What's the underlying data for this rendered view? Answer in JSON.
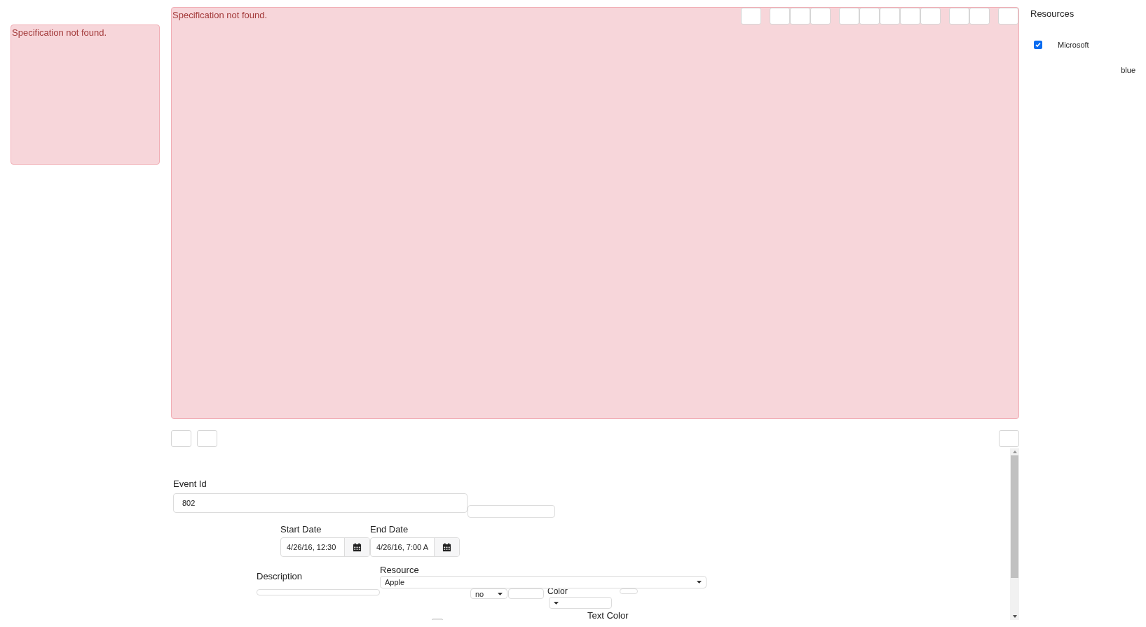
{
  "side_alert": {
    "message": "Specification not found."
  },
  "scheduler": {
    "message": "Specification not found."
  },
  "resources": {
    "title": "Resources",
    "items": [
      {
        "label": "Microsoft",
        "checked": true,
        "color_name": "blue"
      }
    ]
  },
  "form": {
    "event_id": {
      "label": "Event Id",
      "value": "802"
    },
    "start_date": {
      "label": "Start Date",
      "value": "4/26/16, 12:30"
    },
    "end_date": {
      "label": "End Date",
      "value": "4/26/16, 7:00 A"
    },
    "description": {
      "label": "Description"
    },
    "resource": {
      "label": "Resource",
      "value": "Apple"
    },
    "all_day": {
      "value": "no"
    },
    "color": {
      "label": "Color"
    },
    "text_color": {
      "label": "Text Color"
    }
  }
}
